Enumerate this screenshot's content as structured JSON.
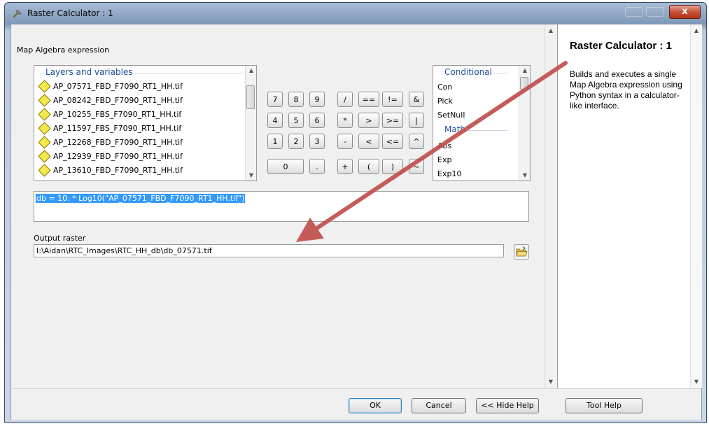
{
  "window": {
    "title": "Raster Calculator : 1",
    "close_glyph": "x"
  },
  "expression_section": {
    "label": "Map Algebra expression"
  },
  "layers": {
    "header": "Layers and variables",
    "items": [
      "AP_07571_FBD_F7090_RT1_HH.tif",
      "AP_08242_FBD_F7090_RT1_HH.tif",
      "AP_10255_FBS_F7090_RT1_HH.tif",
      "AP_11597_FBS_F7090_RT1_HH.tif",
      "AP_12268_FBD_F7090_RT1_HH.tif",
      "AP_12939_FBD_F7090_RT1_HH.tif",
      "AP_13610_FBD_F7090_RT1_HH.tif"
    ]
  },
  "keypad": {
    "row1": [
      "7",
      "8",
      "9",
      "/",
      "==",
      "!=",
      "&"
    ],
    "row2": [
      "4",
      "5",
      "6",
      "*",
      ">",
      ">=",
      "|"
    ],
    "row3": [
      "1",
      "2",
      "3",
      "-",
      "<",
      "<=",
      "^"
    ],
    "row4": [
      "0",
      ".",
      "+",
      "(",
      ")",
      "~"
    ]
  },
  "functions": {
    "header": "Conditional",
    "items": [
      "Con",
      "Pick",
      "SetNull"
    ],
    "math_header": "Math",
    "math_items": [
      "Abs",
      "Exp",
      "Exp10"
    ]
  },
  "expression": {
    "value": "db = 10. * Log10(\"AP_07571_FBD_F7090_RT1_HH.tif\")"
  },
  "output": {
    "label": "Output raster",
    "value": "I:\\Aidan\\RTC_Images\\RTC_HH_db\\db_07571.tif"
  },
  "help": {
    "title": "Raster Calculator : 1",
    "body": "Builds and executes a single Map Algebra expression using Python syntax in a calculator-like interface."
  },
  "buttons": {
    "ok": "OK",
    "cancel": "Cancel",
    "hide_help": "<< Hide Help",
    "tool_help": "Tool Help"
  },
  "colors": {
    "annotation_arrow": "#c0504d",
    "selection": "#3399ff",
    "group_header": "#1f4e99",
    "close_button": "#c8513a"
  },
  "icons": [
    "hammer-icon",
    "folder-open-icon",
    "close-icon",
    "scroll-up-icon",
    "scroll-down-icon"
  ]
}
